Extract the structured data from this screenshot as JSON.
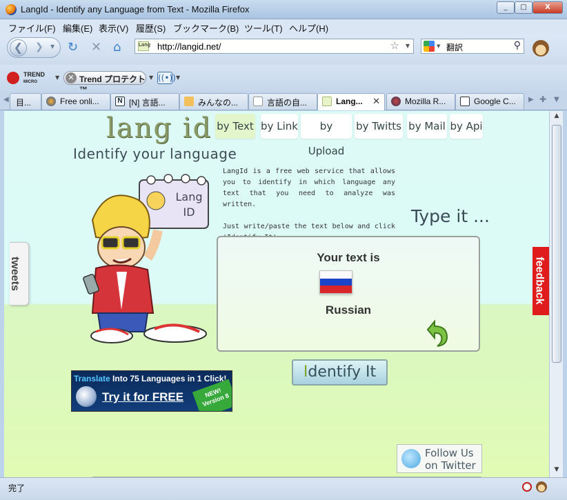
{
  "window": {
    "title": "LangId - Identify any Language from Text - Mozilla Firefox",
    "buttons": [
      "_",
      "□",
      "X"
    ]
  },
  "menubar": [
    "ファイル(F)",
    "編集(E)",
    "表示(V)",
    "履歴(S)",
    "ブックマーク(B)",
    "ツール(T)",
    "ヘルプ(H)"
  ],
  "navbar": {
    "url": "http://langid.net/",
    "favicon_text": "Lang",
    "search_text": "翻訳"
  },
  "addonbar": {
    "trend_brand": "TREND",
    "trend_sub": "MICRO",
    "trend_button": "Trend プロテクト™"
  },
  "tabs": [
    {
      "label": "目...",
      "icon": "generic-icon"
    },
    {
      "label": "Free onli...",
      "icon": "firefox-icon"
    },
    {
      "label": "[N] 言語...",
      "icon": "n-icon"
    },
    {
      "label": "みんなの...",
      "icon": "bookmark-icon"
    },
    {
      "label": "言語の自...",
      "icon": "doc-icon"
    },
    {
      "label": "Lang...",
      "icon": "langid-icon",
      "active": true
    },
    {
      "label": "Mozilla R...",
      "icon": "mozilla-icon"
    },
    {
      "label": "Google C...",
      "icon": "google-icon"
    }
  ],
  "page": {
    "logo": "lang id",
    "tagline": "Identify your language",
    "nav": [
      "by Text",
      "by Link",
      "by Upload",
      "by Twitts",
      "by Mail",
      "by Api"
    ],
    "nav_active": "by Text",
    "intro_p1": "LangId is a free web service that allows you to identify in which language any text that you need to analyze was written.",
    "intro_p2": "Just write/paste the text below and click 'Identify It'.",
    "type_it": "Type it ...",
    "mascot_sign_line1": "Lang",
    "mascot_sign_line2": "ID",
    "result_label": "Your text is",
    "result_language": "Russian",
    "flag_colors": [
      "#fbfbfb",
      "#1b44c8",
      "#d8262b"
    ],
    "identify_button_first": "I",
    "identify_button_rest": "dentify It",
    "tweets_tab": "tweets",
    "feedback_tab": "feedback",
    "ad": {
      "highlight": "Translate",
      "line1_rest": " Into 75 Languages in 1 Click!",
      "cta": "Try it for FREE",
      "badge_line1": "NEW!",
      "badge_line2": "Version 8"
    },
    "follow_line1": "Follow Us",
    "follow_line2": "on Twitter"
  },
  "status": {
    "text": "完了"
  },
  "colors": {
    "accent_green": "#7fa12e",
    "feedback_red": "#e01b1b",
    "page_top": "#ddfaf7",
    "page_bottom": "#e1fbb5"
  }
}
